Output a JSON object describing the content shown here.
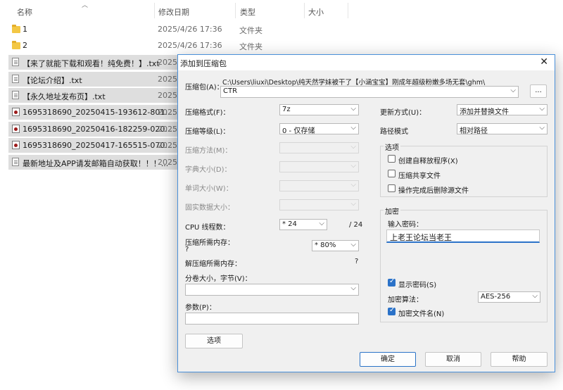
{
  "explorer": {
    "columns": {
      "name": "名称",
      "date": "修改日期",
      "type": "类型",
      "size": "大小"
    },
    "rows": [
      {
        "name": "1",
        "date": "2025/4/26 17:36",
        "type": "文件夹",
        "icon": "folder-icon"
      },
      {
        "name": "2",
        "date": "2025/4/26 17:36",
        "type": "文件夹",
        "icon": "folder-icon"
      },
      {
        "name": "【来了就能下载和观看！纯免费！】.txt",
        "date": "2025/",
        "icon": "text-file-icon"
      },
      {
        "name": "【论坛介绍】.txt",
        "date": "2025/",
        "icon": "text-file-icon"
      },
      {
        "name": "【永久地址发布页】.txt",
        "date": "2025/",
        "icon": "text-file-icon"
      },
      {
        "name": "1695318690_20250415-193612-801....",
        "date": "2025/",
        "icon": "video-file-icon"
      },
      {
        "name": "1695318690_20250416-182259-020....",
        "date": "2025/",
        "icon": "video-file-icon"
      },
      {
        "name": "1695318690_20250417-165515-070....",
        "date": "2025/",
        "icon": "video-file-icon"
      },
      {
        "name": "最新地址及APP请发邮箱自动获取！！！...",
        "date": "2025/",
        "icon": "text-file-icon"
      }
    ]
  },
  "dialog": {
    "title": "添加到压缩包",
    "close_glyph": "✕",
    "archive_label": "压缩包(A)：",
    "archive_path": "C:\\Users\\liuxi\\Desktop\\纯天然学妹被干了【小涵宝宝】刚成年超级粉嫩多场无套\\ghm\\",
    "archive_name": "CTR",
    "browse_label": "...",
    "format_label": "压缩格式(F)：",
    "format_value": "7z",
    "level_label": "压缩等级(L)：",
    "level_value": "0 - 仅存储",
    "method_label": "压缩方法(M)：",
    "dict_label": "字典大小(D)：",
    "word_label": "单词大小(W)：",
    "solid_label": "固实数据大小：",
    "cpu_label": "CPU 线程数：",
    "cpu_value": "* 24",
    "cpu_total": "/ 24",
    "mem_label": "压缩所需内存：",
    "mem_value": "?",
    "mem_select": "* 80%",
    "decomp_label": "解压缩所需内存：",
    "decomp_value": "?",
    "volume_label": "分卷大小，字节(V)：",
    "params_label": "参数(P)：",
    "options_button": "选项",
    "update_label": "更新方式(U)：",
    "update_value": "添加并替换文件",
    "path_label": "路径模式",
    "path_value": "相对路径",
    "options_group": "选项",
    "opt_sfx": "创建自释放程序(X)",
    "opt_shared": "压缩共享文件",
    "opt_delete": "操作完成后删除源文件",
    "encrypt_group": "加密",
    "password_label": "输入密码：",
    "password_value": "上老王论坛当老王",
    "show_password": "显示密码(S)",
    "encrypt_method_label": "加密算法：",
    "encrypt_method_value": "AES-256",
    "encrypt_names": "加密文件名(N)",
    "ok_button": "确定",
    "cancel_button": "取消",
    "help_button": "帮助",
    "dropdown_arrow": "⌵"
  }
}
